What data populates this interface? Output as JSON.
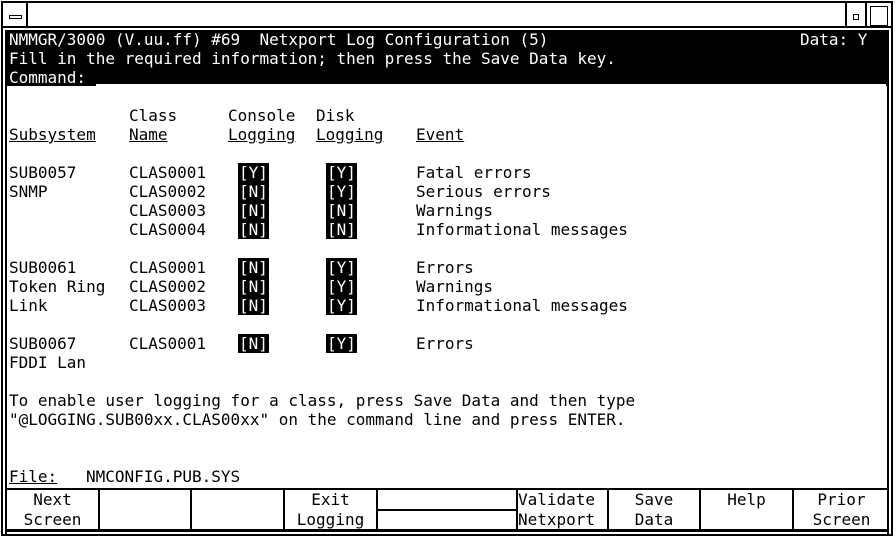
{
  "header": {
    "app_title": "NMMGR/3000 (V.uu.ff) #69  Netxport Log Configuration (5)",
    "data_flag_label": "Data: Y",
    "instruction": "Fill in the required information; then press the Save Data key.",
    "command_label": "Command:",
    "command_value": ""
  },
  "columns": {
    "subsystem": "Subsystem",
    "class_line1": "Class",
    "class_line2": "Name",
    "console_line1": "Console",
    "console_line2": "Logging",
    "disk_line1": "Disk",
    "disk_line2": "Logging",
    "event": "Event"
  },
  "groups": [
    {
      "subsystem_id": "SUB0057",
      "subsystem_name": "SNMP",
      "rows": [
        {
          "class": "CLAS0001",
          "console": "Y",
          "disk": "Y",
          "event": "Fatal errors"
        },
        {
          "class": "CLAS0002",
          "console": "N",
          "disk": "Y",
          "event": "Serious errors"
        },
        {
          "class": "CLAS0003",
          "console": "N",
          "disk": "N",
          "event": "Warnings"
        },
        {
          "class": "CLAS0004",
          "console": "N",
          "disk": "N",
          "event": "Informational messages"
        }
      ]
    },
    {
      "subsystem_id": "SUB0061",
      "subsystem_name": "Token Ring",
      "subsystem_name2": "Link",
      "rows": [
        {
          "class": "CLAS0001",
          "console": "N",
          "disk": "Y",
          "event": "Errors"
        },
        {
          "class": "CLAS0002",
          "console": "N",
          "disk": "Y",
          "event": "Warnings"
        },
        {
          "class": "CLAS0003",
          "console": "N",
          "disk": "Y",
          "event": "Informational messages"
        }
      ]
    },
    {
      "subsystem_id": "SUB0067",
      "subsystem_name": "FDDI Lan",
      "rows": [
        {
          "class": "CLAS0001",
          "console": "N",
          "disk": "Y",
          "event": "Errors"
        }
      ]
    }
  ],
  "note": {
    "line1": "To enable user logging for a class, press Save Data and then type",
    "line2": "\"@LOGGING.SUB00xx.CLAS00xx\" on the command line and press ENTER."
  },
  "file": {
    "label": "File:",
    "value": "NMCONFIG.PUB.SYS"
  },
  "softkeys": [
    {
      "line1": "Next",
      "line2": "Screen"
    },
    {
      "line1": "",
      "line2": ""
    },
    {
      "line1": "",
      "line2": ""
    },
    {
      "line1": "Exit",
      "line2": "Logging"
    },
    {
      "line1": "",
      "line2": ""
    },
    {
      "line1": "Validate",
      "line2": "Netxport"
    },
    {
      "line1": "Save",
      "line2": "Data"
    },
    {
      "line1": "Help",
      "line2": ""
    },
    {
      "line1": "Prior",
      "line2": "Screen"
    }
  ]
}
